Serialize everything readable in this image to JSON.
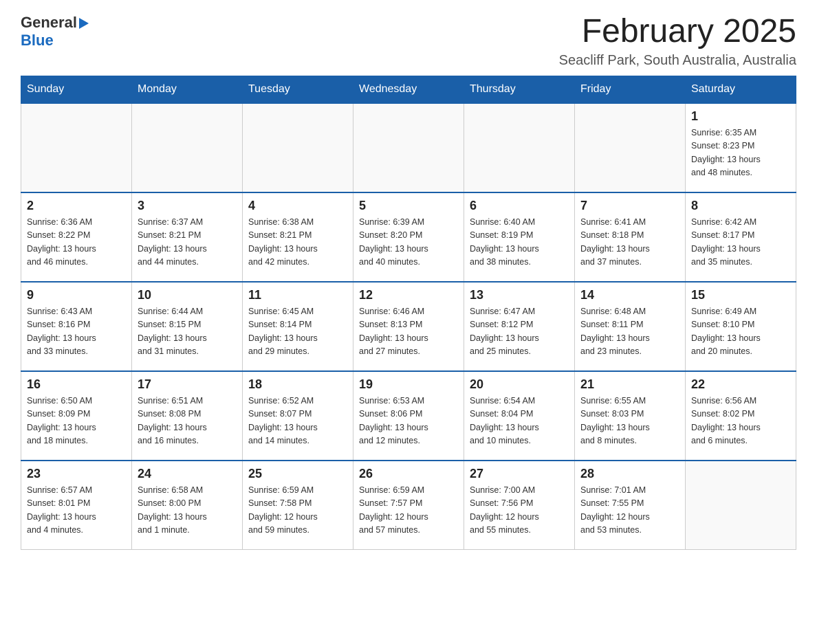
{
  "header": {
    "logo_general": "General",
    "logo_blue": "Blue",
    "title": "February 2025",
    "location": "Seacliff Park, South Australia, Australia"
  },
  "weekdays": [
    "Sunday",
    "Monday",
    "Tuesday",
    "Wednesday",
    "Thursday",
    "Friday",
    "Saturday"
  ],
  "weeks": [
    [
      {
        "day": "",
        "info": ""
      },
      {
        "day": "",
        "info": ""
      },
      {
        "day": "",
        "info": ""
      },
      {
        "day": "",
        "info": ""
      },
      {
        "day": "",
        "info": ""
      },
      {
        "day": "",
        "info": ""
      },
      {
        "day": "1",
        "info": "Sunrise: 6:35 AM\nSunset: 8:23 PM\nDaylight: 13 hours\nand 48 minutes."
      }
    ],
    [
      {
        "day": "2",
        "info": "Sunrise: 6:36 AM\nSunset: 8:22 PM\nDaylight: 13 hours\nand 46 minutes."
      },
      {
        "day": "3",
        "info": "Sunrise: 6:37 AM\nSunset: 8:21 PM\nDaylight: 13 hours\nand 44 minutes."
      },
      {
        "day": "4",
        "info": "Sunrise: 6:38 AM\nSunset: 8:21 PM\nDaylight: 13 hours\nand 42 minutes."
      },
      {
        "day": "5",
        "info": "Sunrise: 6:39 AM\nSunset: 8:20 PM\nDaylight: 13 hours\nand 40 minutes."
      },
      {
        "day": "6",
        "info": "Sunrise: 6:40 AM\nSunset: 8:19 PM\nDaylight: 13 hours\nand 38 minutes."
      },
      {
        "day": "7",
        "info": "Sunrise: 6:41 AM\nSunset: 8:18 PM\nDaylight: 13 hours\nand 37 minutes."
      },
      {
        "day": "8",
        "info": "Sunrise: 6:42 AM\nSunset: 8:17 PM\nDaylight: 13 hours\nand 35 minutes."
      }
    ],
    [
      {
        "day": "9",
        "info": "Sunrise: 6:43 AM\nSunset: 8:16 PM\nDaylight: 13 hours\nand 33 minutes."
      },
      {
        "day": "10",
        "info": "Sunrise: 6:44 AM\nSunset: 8:15 PM\nDaylight: 13 hours\nand 31 minutes."
      },
      {
        "day": "11",
        "info": "Sunrise: 6:45 AM\nSunset: 8:14 PM\nDaylight: 13 hours\nand 29 minutes."
      },
      {
        "day": "12",
        "info": "Sunrise: 6:46 AM\nSunset: 8:13 PM\nDaylight: 13 hours\nand 27 minutes."
      },
      {
        "day": "13",
        "info": "Sunrise: 6:47 AM\nSunset: 8:12 PM\nDaylight: 13 hours\nand 25 minutes."
      },
      {
        "day": "14",
        "info": "Sunrise: 6:48 AM\nSunset: 8:11 PM\nDaylight: 13 hours\nand 23 minutes."
      },
      {
        "day": "15",
        "info": "Sunrise: 6:49 AM\nSunset: 8:10 PM\nDaylight: 13 hours\nand 20 minutes."
      }
    ],
    [
      {
        "day": "16",
        "info": "Sunrise: 6:50 AM\nSunset: 8:09 PM\nDaylight: 13 hours\nand 18 minutes."
      },
      {
        "day": "17",
        "info": "Sunrise: 6:51 AM\nSunset: 8:08 PM\nDaylight: 13 hours\nand 16 minutes."
      },
      {
        "day": "18",
        "info": "Sunrise: 6:52 AM\nSunset: 8:07 PM\nDaylight: 13 hours\nand 14 minutes."
      },
      {
        "day": "19",
        "info": "Sunrise: 6:53 AM\nSunset: 8:06 PM\nDaylight: 13 hours\nand 12 minutes."
      },
      {
        "day": "20",
        "info": "Sunrise: 6:54 AM\nSunset: 8:04 PM\nDaylight: 13 hours\nand 10 minutes."
      },
      {
        "day": "21",
        "info": "Sunrise: 6:55 AM\nSunset: 8:03 PM\nDaylight: 13 hours\nand 8 minutes."
      },
      {
        "day": "22",
        "info": "Sunrise: 6:56 AM\nSunset: 8:02 PM\nDaylight: 13 hours\nand 6 minutes."
      }
    ],
    [
      {
        "day": "23",
        "info": "Sunrise: 6:57 AM\nSunset: 8:01 PM\nDaylight: 13 hours\nand 4 minutes."
      },
      {
        "day": "24",
        "info": "Sunrise: 6:58 AM\nSunset: 8:00 PM\nDaylight: 13 hours\nand 1 minute."
      },
      {
        "day": "25",
        "info": "Sunrise: 6:59 AM\nSunset: 7:58 PM\nDaylight: 12 hours\nand 59 minutes."
      },
      {
        "day": "26",
        "info": "Sunrise: 6:59 AM\nSunset: 7:57 PM\nDaylight: 12 hours\nand 57 minutes."
      },
      {
        "day": "27",
        "info": "Sunrise: 7:00 AM\nSunset: 7:56 PM\nDaylight: 12 hours\nand 55 minutes."
      },
      {
        "day": "28",
        "info": "Sunrise: 7:01 AM\nSunset: 7:55 PM\nDaylight: 12 hours\nand 53 minutes."
      },
      {
        "day": "",
        "info": ""
      }
    ]
  ]
}
